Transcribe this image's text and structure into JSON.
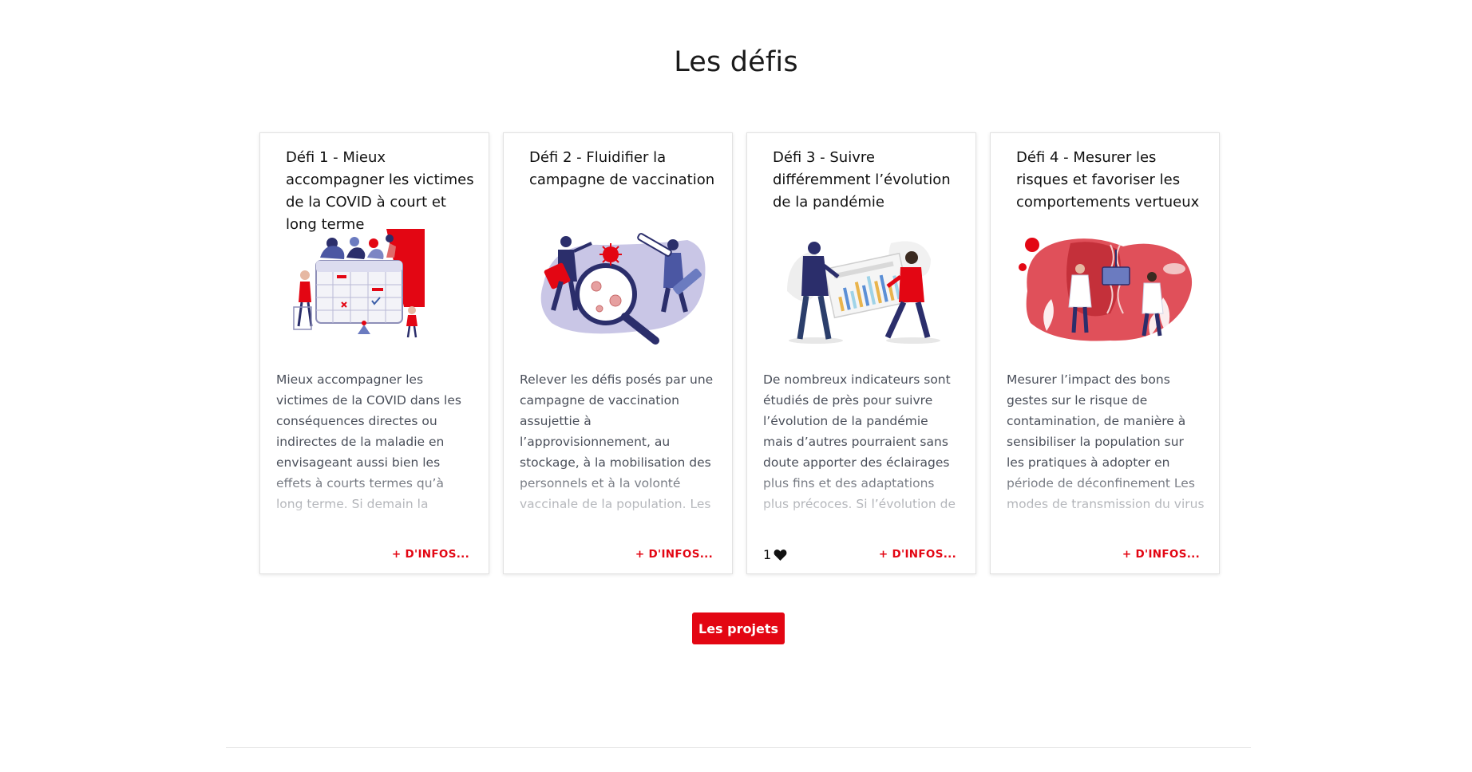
{
  "section": {
    "title": "Les défis"
  },
  "challenges": [
    {
      "title": "Défi 1 - Mieux accompagner les victimes de la COVID à court et long terme",
      "description": "Mieux accompagner les victimes de la COVID dans les conséquences directes ou indirectes de la maladie en envisageant aussi bien les effets à courts termes qu’à long terme. Si demain la pandémie vient à se résorber,…",
      "more_label": "+ D'INFOS...",
      "illustration": "calendar-illustration"
    },
    {
      "title": "Défi 2 - Fluidifier la campagne de vaccination",
      "description": "Relever les défis posés par une campagne de vaccination assujettie à l’approvisionnement, au stockage, à la mobilisation des personnels et à la volonté vaccinale de la population. Les besoins relatifs à la campagne de…",
      "more_label": "+ D'INFOS...",
      "illustration": "vaccination-illustration"
    },
    {
      "title": "Défi 3 - Suivre différemment l’évolution de la pandémie",
      "description": "De nombreux indicateurs sont étudiés de près pour suivre l’évolution de la pandémie mais d’autres pourraient sans doute apporter des éclairages plus fins et des adaptations plus précoces. Si l’évolution de la pandémie…",
      "more_label": "+ D'INFOS...",
      "likes": "1",
      "illustration": "chart-illustration"
    },
    {
      "title": "Défi 4 - Mesurer les risques et favoriser les comportements vertueux",
      "description": "Mesurer l’impact des bons gestes sur le risque de contamination, de manière à sensibiliser la population sur les pratiques à adopter en période de déconfinement Les modes de transmission du virus sont désormais mieux…",
      "more_label": "+ D'INFOS...",
      "illustration": "lab-illustration"
    }
  ],
  "actions": {
    "projects_label": "Les projets"
  },
  "colors": {
    "accent": "#e30613",
    "navy": "#2b2e6b",
    "lavender": "#c9c6e6",
    "text": "#4a4f5a"
  }
}
